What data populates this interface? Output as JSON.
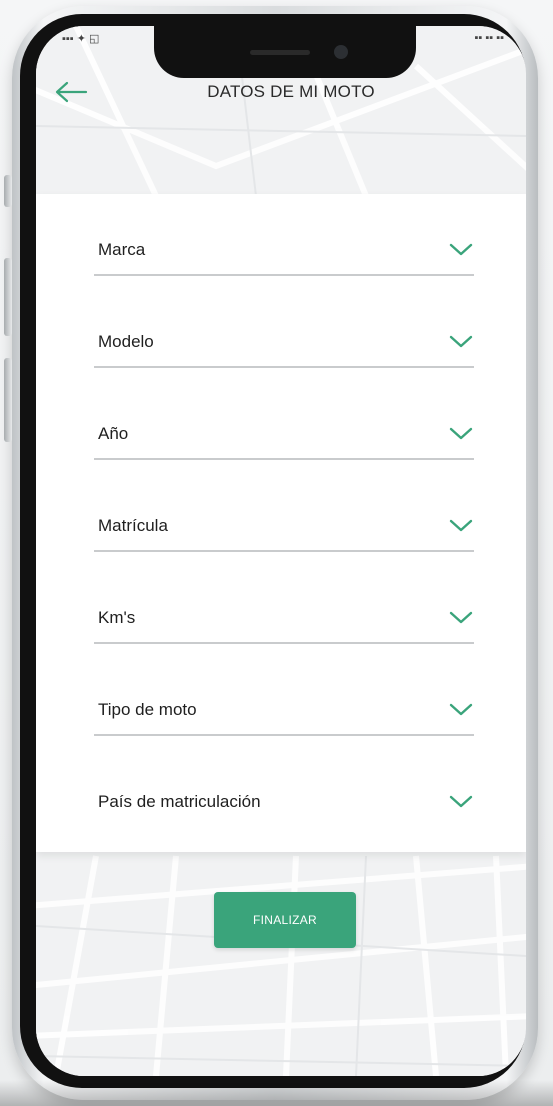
{
  "header": {
    "title": "DATOS DE MI MOTO"
  },
  "status": {
    "left": "▪▪▪ ✦ ◱",
    "right": "▪▪ ▪▪ ▪▪"
  },
  "form": {
    "fields": [
      {
        "label": "Marca"
      },
      {
        "label": "Modelo"
      },
      {
        "label": "Año"
      },
      {
        "label": "Matrícula"
      },
      {
        "label": "Km's"
      },
      {
        "label": "Tipo de moto"
      },
      {
        "label": "País de matriculación"
      }
    ]
  },
  "actions": {
    "finish_label": "FINALIZAR"
  },
  "colors": {
    "accent": "#3aa47b",
    "divider": "#c9cbcd"
  },
  "icons": {
    "back": "arrow-left-icon",
    "field_chevron": "chevron-down-icon"
  }
}
